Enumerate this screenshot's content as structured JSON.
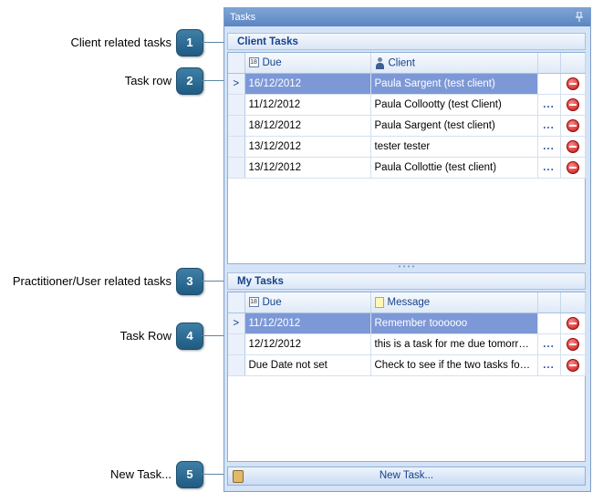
{
  "callouts": [
    {
      "number": "1",
      "label": "Client related tasks"
    },
    {
      "number": "2",
      "label": "Task row"
    },
    {
      "number": "3",
      "label": "Practitioner/User related tasks"
    },
    {
      "number": "4",
      "label": "Task Row"
    },
    {
      "number": "5",
      "label": "New Task..."
    }
  ],
  "panel": {
    "title": "Tasks",
    "client_section": {
      "title": "Client Tasks",
      "columns": {
        "due": "Due",
        "client": "Client"
      },
      "rows": [
        {
          "due": "16/12/2012",
          "client": "Paula Sargent (test client)"
        },
        {
          "due": "11/12/2012",
          "client": "Paula Collootty (test Client)"
        },
        {
          "due": "18/12/2012",
          "client": "Paula Sargent (test client)"
        },
        {
          "due": "13/12/2012",
          "client": "tester tester"
        },
        {
          "due": "13/12/2012",
          "client": "Paula Collottie (test client)"
        }
      ]
    },
    "my_section": {
      "title": "My Tasks",
      "columns": {
        "due": "Due",
        "message": "Message"
      },
      "rows": [
        {
          "due": "11/12/2012",
          "message": "Remember toooooo"
        },
        {
          "due": "12/12/2012",
          "message": "this is a task for me due tomorrow..."
        },
        {
          "due": "Due Date not set",
          "message": "Check to see if the two tasks for ..."
        }
      ]
    },
    "row_indicator": ">",
    "row_menu": "...",
    "calendar_icon_text": "18",
    "new_task_label": "New Task..."
  },
  "colors": {
    "accent": "#15428b",
    "selected_row": "#7d98d6",
    "panel_bg": "#d5e3f6"
  }
}
